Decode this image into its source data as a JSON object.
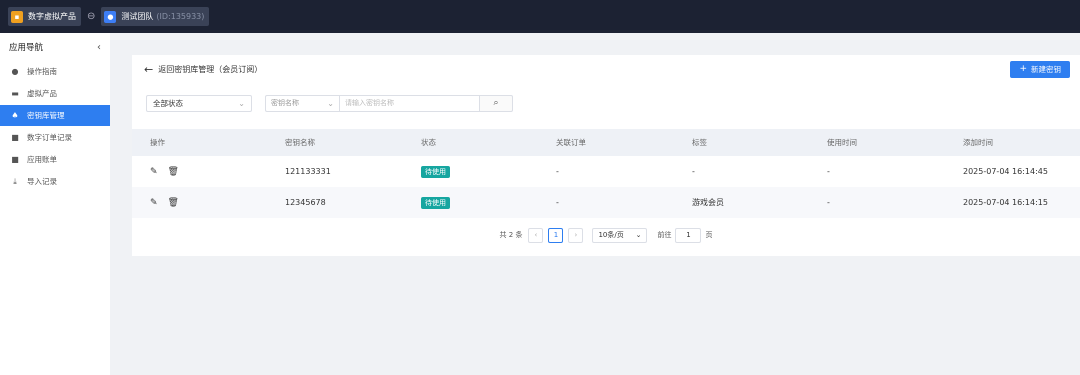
{
  "topbar": {
    "app_name": "数字虚拟产品",
    "org_name": "测试团队",
    "org_id": "(ID:135933)",
    "app_icon": "folder-icon",
    "org_icon": "user-icon",
    "link_icon": "link-icon"
  },
  "sidebar": {
    "title": "应用导航",
    "items": [
      {
        "label": "操作指南",
        "icon": "guide-icon",
        "glyph": "●",
        "active": false
      },
      {
        "label": "虚拟产品",
        "icon": "folder-icon",
        "glyph": "▬",
        "active": false
      },
      {
        "label": "密钥库管理",
        "icon": "key-icon",
        "glyph": "♠",
        "active": true
      },
      {
        "label": "数字订单记录",
        "icon": "clipboard-icon",
        "glyph": "■",
        "active": false
      },
      {
        "label": "应用账单",
        "icon": "document-icon",
        "glyph": "■",
        "active": false
      },
      {
        "label": "导入记录",
        "icon": "download-icon",
        "glyph": "⤓",
        "active": false
      }
    ]
  },
  "header": {
    "back_label": "返回密钥库管理（会员订阅）",
    "new_key_label": "新建密钥"
  },
  "filters": {
    "status_value": "全部状态",
    "field_value": "密钥名称",
    "search_placeholder": "请输入密钥名称"
  },
  "table": {
    "columns": [
      "操作",
      "密钥名称",
      "状态",
      "关联订单",
      "标签",
      "使用时间",
      "添加时间"
    ],
    "rows": [
      {
        "name": "121133331",
        "status": "待使用",
        "order": "-",
        "tag": "-",
        "used_at": "-",
        "added_at": "2025-07-04 16:14:45"
      },
      {
        "name": "12345678",
        "status": "待使用",
        "order": "-",
        "tag": "游戏会员",
        "used_at": "-",
        "added_at": "2025-07-04 16:14:15"
      }
    ]
  },
  "pagination": {
    "total": "共 2 条",
    "current_page": "1",
    "page_size": "10条/页",
    "goto_label": "前往",
    "goto_value": "1",
    "page_suffix": "页"
  },
  "colors": {
    "accent": "#2e7ef0",
    "topbar": "#1c2233",
    "status_tag": "#16a6a0"
  }
}
